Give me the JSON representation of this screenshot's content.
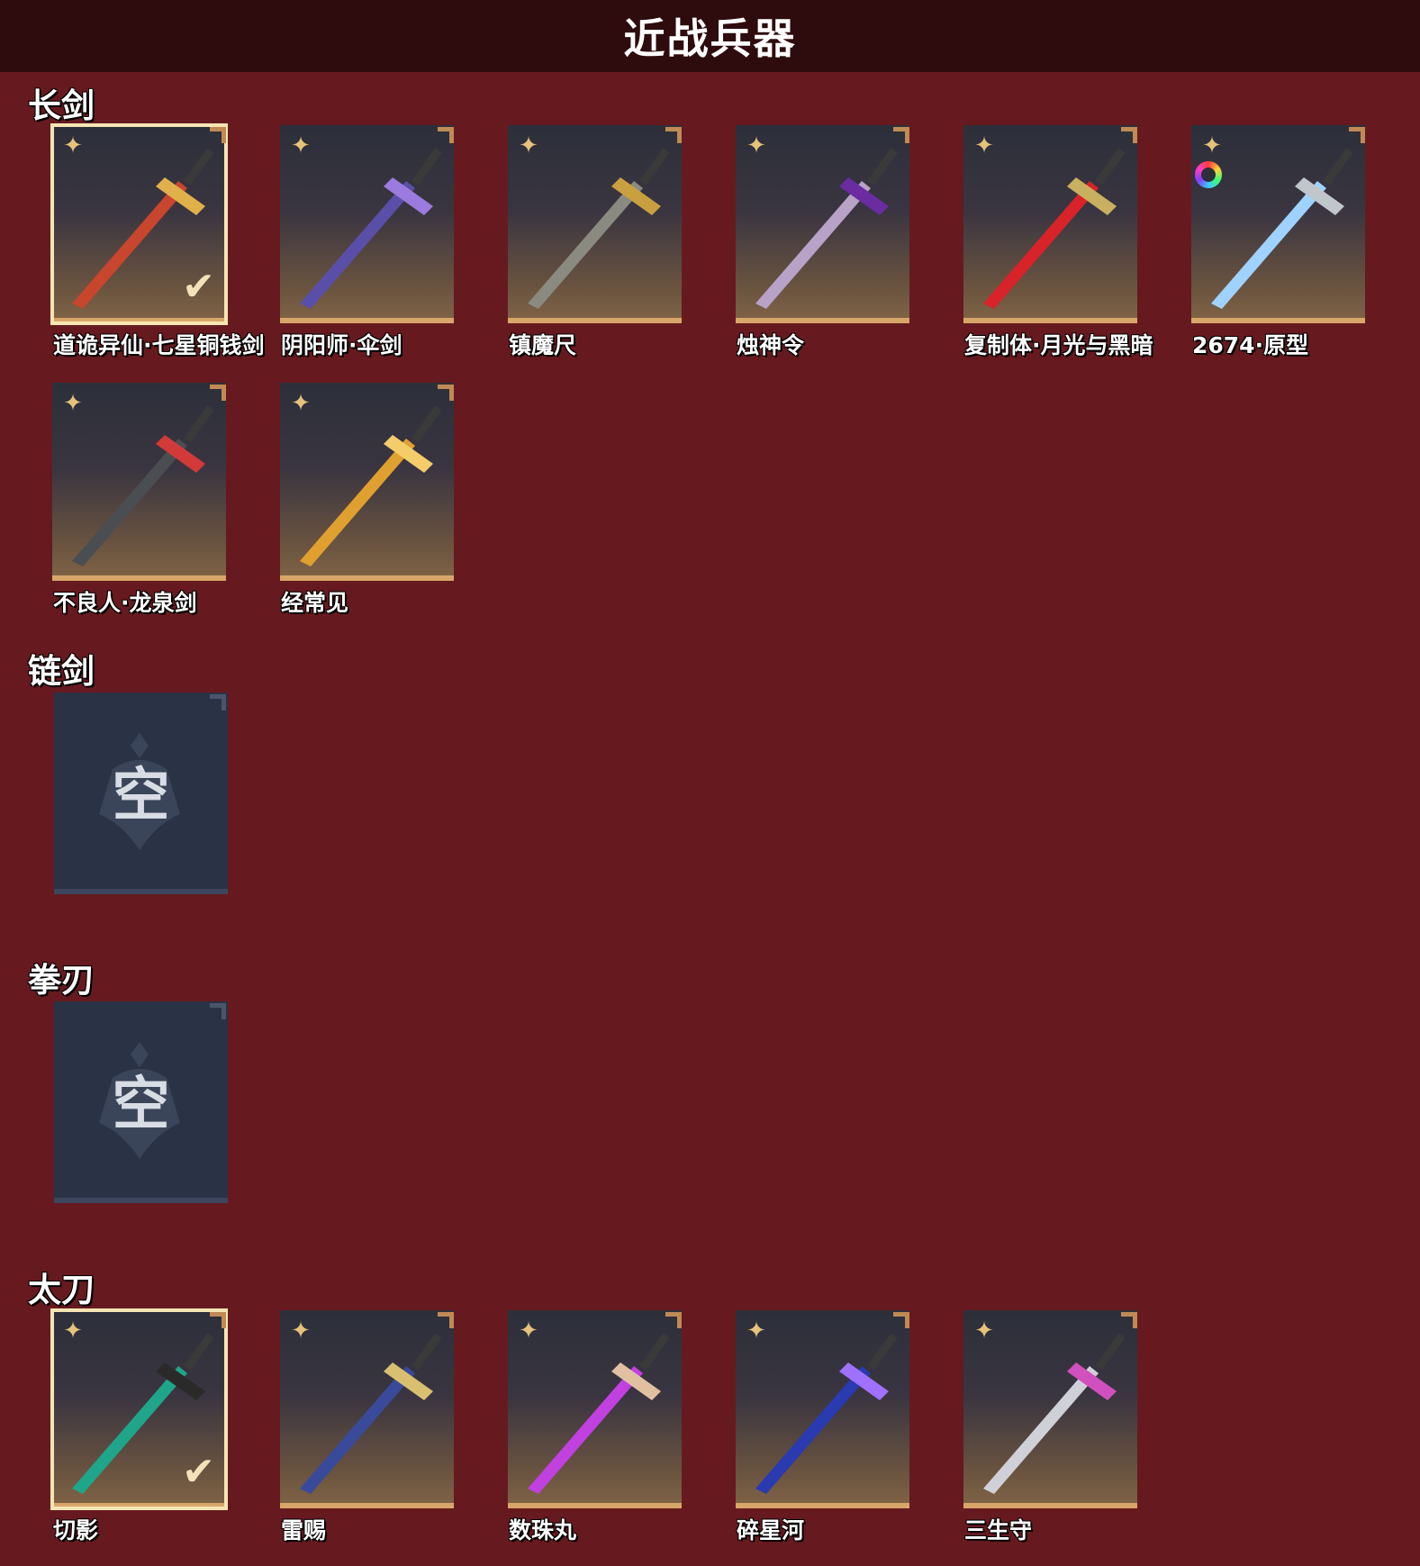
{
  "header": {
    "title": "近战兵器"
  },
  "sections": {
    "changjian": {
      "title": "长剑",
      "items": [
        {
          "name": "道诡异仙·七星铜钱剑",
          "selected": true,
          "blade": "#c8452e",
          "accent": "#e0b04a"
        },
        {
          "name": "阴阳师·伞剑",
          "selected": false,
          "blade": "#5a4fa8",
          "accent": "#9b7be0"
        },
        {
          "name": "镇魔尺",
          "selected": false,
          "blade": "#8a8a80",
          "accent": "#c9a040"
        },
        {
          "name": "烛神令",
          "selected": false,
          "blade": "#b9a2c8",
          "accent": "#6a2ca0"
        },
        {
          "name": "复制体·月光与黑暗",
          "selected": false,
          "blade": "#d8232a",
          "accent": "#c9b060"
        },
        {
          "name": "2674·原型",
          "selected": false,
          "blade": "#9fd2ff",
          "accent": "#c0c6cc",
          "rainbow": true
        }
      ],
      "items_row2": [
        {
          "name": "不良人·龙泉剑",
          "selected": false,
          "blade": "#4a4d52",
          "accent": "#d23a3a"
        },
        {
          "name": "经常见",
          "selected": false,
          "blade": "#e0a030",
          "accent": "#f4cd6a"
        }
      ]
    },
    "lianjian": {
      "title": "链剑",
      "empty_text": "空"
    },
    "quanren": {
      "title": "拳刃",
      "empty_text": "空"
    },
    "taidao": {
      "title": "太刀",
      "items": [
        {
          "name": "切影",
          "selected": true,
          "blade": "#1fa58a",
          "accent": "#2a2a2a"
        },
        {
          "name": "雷赐",
          "selected": false,
          "blade": "#3a4a9a",
          "accent": "#d8c070"
        },
        {
          "name": "数珠丸",
          "selected": false,
          "blade": "#c040e0",
          "accent": "#e0c0a0"
        },
        {
          "name": "碎星河",
          "selected": false,
          "blade": "#2a3ab0",
          "accent": "#a070ff"
        },
        {
          "name": "三生守",
          "selected": false,
          "blade": "#d0d0d8",
          "accent": "#d050c0"
        }
      ]
    }
  },
  "icons": {
    "star": "shuriken-star-icon",
    "check": "checkmark-icon",
    "rarity": "rainbow-ring-icon"
  }
}
